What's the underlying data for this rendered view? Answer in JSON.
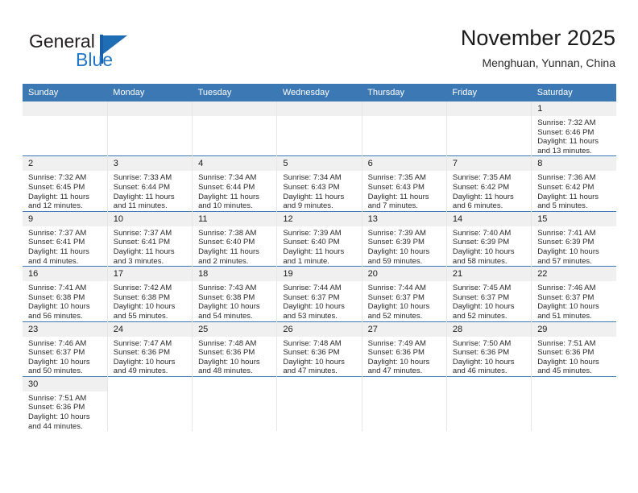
{
  "brand": {
    "name_top": "General",
    "name_bottom": "Blue",
    "logo_color": "#1f6db5",
    "text_color": "#231f20"
  },
  "header": {
    "title": "November 2025",
    "subtitle": "Menghuan, Yunnan, China"
  },
  "theme": {
    "header_bar": "#3c78b4",
    "daynum_bg": "#f0f0f0",
    "grid_line": "#3c78b4",
    "cell_divider": "#e6e6e6"
  },
  "weekdays": [
    "Sunday",
    "Monday",
    "Tuesday",
    "Wednesday",
    "Thursday",
    "Friday",
    "Saturday"
  ],
  "labels": {
    "sunrise": "Sunrise:",
    "sunset": "Sunset:",
    "daylight": "Daylight:"
  },
  "weeks": [
    [
      {
        "blank": true,
        "day": ""
      },
      {
        "blank": true,
        "day": ""
      },
      {
        "blank": true,
        "day": ""
      },
      {
        "blank": true,
        "day": ""
      },
      {
        "blank": true,
        "day": ""
      },
      {
        "blank": true,
        "day": ""
      },
      {
        "day": "1",
        "sunrise": "Sunrise: 7:32 AM",
        "sunset": "Sunset: 6:46 PM",
        "daylight": "Daylight: 11 hours and 13 minutes."
      }
    ],
    [
      {
        "day": "2",
        "sunrise": "Sunrise: 7:32 AM",
        "sunset": "Sunset: 6:45 PM",
        "daylight": "Daylight: 11 hours and 12 minutes."
      },
      {
        "day": "3",
        "sunrise": "Sunrise: 7:33 AM",
        "sunset": "Sunset: 6:44 PM",
        "daylight": "Daylight: 11 hours and 11 minutes."
      },
      {
        "day": "4",
        "sunrise": "Sunrise: 7:34 AM",
        "sunset": "Sunset: 6:44 PM",
        "daylight": "Daylight: 11 hours and 10 minutes."
      },
      {
        "day": "5",
        "sunrise": "Sunrise: 7:34 AM",
        "sunset": "Sunset: 6:43 PM",
        "daylight": "Daylight: 11 hours and 9 minutes."
      },
      {
        "day": "6",
        "sunrise": "Sunrise: 7:35 AM",
        "sunset": "Sunset: 6:43 PM",
        "daylight": "Daylight: 11 hours and 7 minutes."
      },
      {
        "day": "7",
        "sunrise": "Sunrise: 7:35 AM",
        "sunset": "Sunset: 6:42 PM",
        "daylight": "Daylight: 11 hours and 6 minutes."
      },
      {
        "day": "8",
        "sunrise": "Sunrise: 7:36 AM",
        "sunset": "Sunset: 6:42 PM",
        "daylight": "Daylight: 11 hours and 5 minutes."
      }
    ],
    [
      {
        "day": "9",
        "sunrise": "Sunrise: 7:37 AM",
        "sunset": "Sunset: 6:41 PM",
        "daylight": "Daylight: 11 hours and 4 minutes."
      },
      {
        "day": "10",
        "sunrise": "Sunrise: 7:37 AM",
        "sunset": "Sunset: 6:41 PM",
        "daylight": "Daylight: 11 hours and 3 minutes."
      },
      {
        "day": "11",
        "sunrise": "Sunrise: 7:38 AM",
        "sunset": "Sunset: 6:40 PM",
        "daylight": "Daylight: 11 hours and 2 minutes."
      },
      {
        "day": "12",
        "sunrise": "Sunrise: 7:39 AM",
        "sunset": "Sunset: 6:40 PM",
        "daylight": "Daylight: 11 hours and 1 minute."
      },
      {
        "day": "13",
        "sunrise": "Sunrise: 7:39 AM",
        "sunset": "Sunset: 6:39 PM",
        "daylight": "Daylight: 10 hours and 59 minutes."
      },
      {
        "day": "14",
        "sunrise": "Sunrise: 7:40 AM",
        "sunset": "Sunset: 6:39 PM",
        "daylight": "Daylight: 10 hours and 58 minutes."
      },
      {
        "day": "15",
        "sunrise": "Sunrise: 7:41 AM",
        "sunset": "Sunset: 6:39 PM",
        "daylight": "Daylight: 10 hours and 57 minutes."
      }
    ],
    [
      {
        "day": "16",
        "sunrise": "Sunrise: 7:41 AM",
        "sunset": "Sunset: 6:38 PM",
        "daylight": "Daylight: 10 hours and 56 minutes."
      },
      {
        "day": "17",
        "sunrise": "Sunrise: 7:42 AM",
        "sunset": "Sunset: 6:38 PM",
        "daylight": "Daylight: 10 hours and 55 minutes."
      },
      {
        "day": "18",
        "sunrise": "Sunrise: 7:43 AM",
        "sunset": "Sunset: 6:38 PM",
        "daylight": "Daylight: 10 hours and 54 minutes."
      },
      {
        "day": "19",
        "sunrise": "Sunrise: 7:44 AM",
        "sunset": "Sunset: 6:37 PM",
        "daylight": "Daylight: 10 hours and 53 minutes."
      },
      {
        "day": "20",
        "sunrise": "Sunrise: 7:44 AM",
        "sunset": "Sunset: 6:37 PM",
        "daylight": "Daylight: 10 hours and 52 minutes."
      },
      {
        "day": "21",
        "sunrise": "Sunrise: 7:45 AM",
        "sunset": "Sunset: 6:37 PM",
        "daylight": "Daylight: 10 hours and 52 minutes."
      },
      {
        "day": "22",
        "sunrise": "Sunrise: 7:46 AM",
        "sunset": "Sunset: 6:37 PM",
        "daylight": "Daylight: 10 hours and 51 minutes."
      }
    ],
    [
      {
        "day": "23",
        "sunrise": "Sunrise: 7:46 AM",
        "sunset": "Sunset: 6:37 PM",
        "daylight": "Daylight: 10 hours and 50 minutes."
      },
      {
        "day": "24",
        "sunrise": "Sunrise: 7:47 AM",
        "sunset": "Sunset: 6:36 PM",
        "daylight": "Daylight: 10 hours and 49 minutes."
      },
      {
        "day": "25",
        "sunrise": "Sunrise: 7:48 AM",
        "sunset": "Sunset: 6:36 PM",
        "daylight": "Daylight: 10 hours and 48 minutes."
      },
      {
        "day": "26",
        "sunrise": "Sunrise: 7:48 AM",
        "sunset": "Sunset: 6:36 PM",
        "daylight": "Daylight: 10 hours and 47 minutes."
      },
      {
        "day": "27",
        "sunrise": "Sunrise: 7:49 AM",
        "sunset": "Sunset: 6:36 PM",
        "daylight": "Daylight: 10 hours and 47 minutes."
      },
      {
        "day": "28",
        "sunrise": "Sunrise: 7:50 AM",
        "sunset": "Sunset: 6:36 PM",
        "daylight": "Daylight: 10 hours and 46 minutes."
      },
      {
        "day": "29",
        "sunrise": "Sunrise: 7:51 AM",
        "sunset": "Sunset: 6:36 PM",
        "daylight": "Daylight: 10 hours and 45 minutes."
      }
    ],
    [
      {
        "day": "30",
        "sunrise": "Sunrise: 7:51 AM",
        "sunset": "Sunset: 6:36 PM",
        "daylight": "Daylight: 10 hours and 44 minutes."
      },
      {
        "blank": true,
        "day": ""
      },
      {
        "blank": true,
        "day": ""
      },
      {
        "blank": true,
        "day": ""
      },
      {
        "blank": true,
        "day": ""
      },
      {
        "blank": true,
        "day": ""
      },
      {
        "blank": true,
        "day": ""
      }
    ]
  ]
}
